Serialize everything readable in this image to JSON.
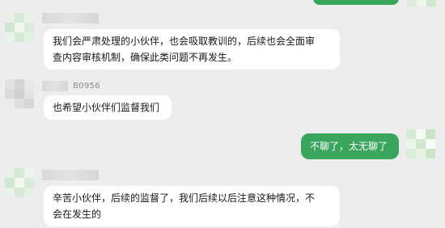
{
  "chat": {
    "messages": [
      {
        "from": "other",
        "sender_suffix": "",
        "text": "我们会严肃处理的小伙伴，也会吸取教训的，后续也会全面审\n查内容审核机制，确保此类问题不再发生。"
      },
      {
        "from": "other",
        "sender_suffix": "B0956",
        "text": "也希望小伙伴们监督我们"
      },
      {
        "from": "self",
        "sender_suffix": "",
        "text": "不聊了，太无聊了"
      },
      {
        "from": "other",
        "sender_suffix": "",
        "text": "辛苦小伙伴，后续的监督了，我们后续以后注意这种情况，不\n会在发生的"
      }
    ]
  },
  "colors": {
    "background": "#ededed",
    "other_bubble": "#ffffff",
    "self_bubble": "#3aa55c",
    "self_text": "#ffffff"
  }
}
